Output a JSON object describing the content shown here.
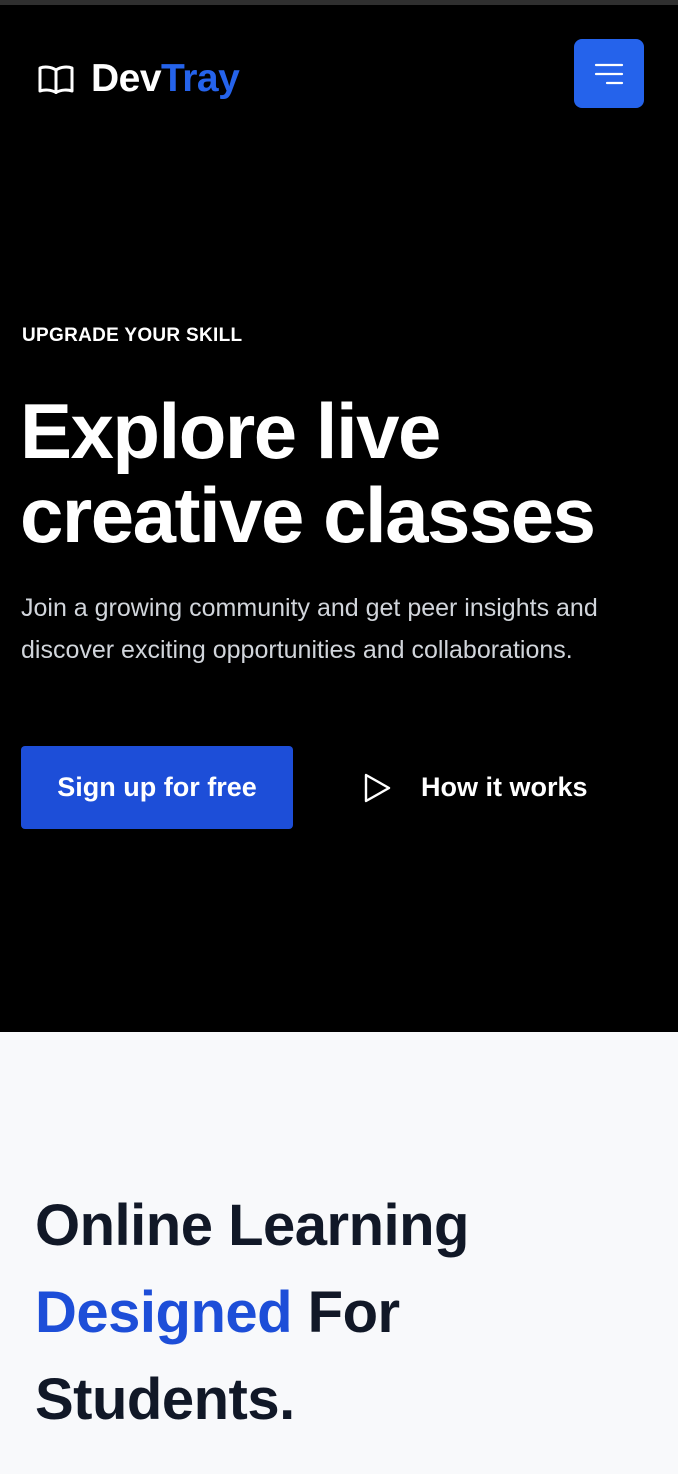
{
  "header": {
    "brand_part1": "Dev",
    "brand_part2": "Tray",
    "brand_icon": "book-open-icon",
    "menu_icon": "menu-icon"
  },
  "hero": {
    "eyebrow": "UPGRADE YOUR SKILL",
    "title_line1": "Explore live",
    "title_line2": "creative classes",
    "subtitle": "Join a growing community and get peer insights and discover exciting opportunities and collaborations.",
    "primary_cta": "Sign up for free",
    "secondary_cta": "How it works",
    "secondary_icon": "play-icon"
  },
  "learning_section": {
    "title_line1": "Online Learning",
    "title_accent": "Designed",
    "title_line2_rest": " For",
    "title_line3": "Students."
  },
  "colors": {
    "accent": "#2563eb",
    "button": "#1d4ed8",
    "hero_bg": "#000000",
    "section_bg": "#f8f9fb",
    "heading_dark": "#111827"
  }
}
